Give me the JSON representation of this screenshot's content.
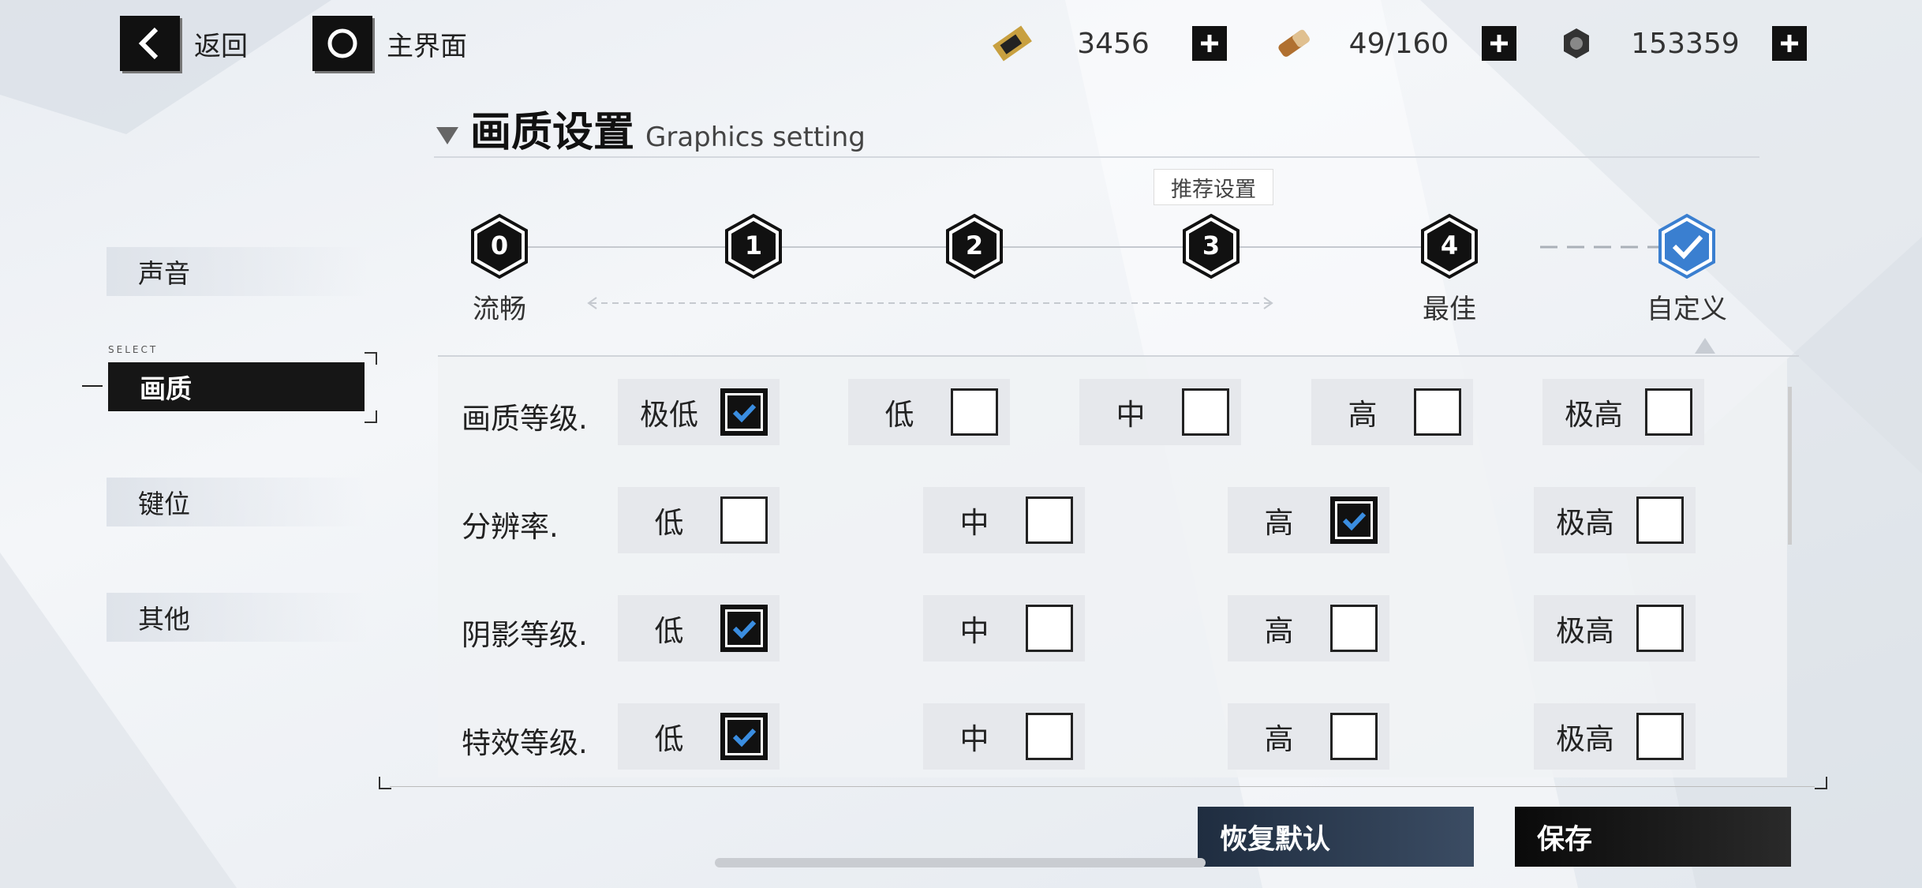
{
  "top": {
    "back_label": "返回",
    "home_label": "主界面",
    "resources": [
      {
        "icon": "ticket-icon",
        "value": "3456"
      },
      {
        "icon": "stamina-icon",
        "value": "49/160"
      },
      {
        "icon": "gear-icon",
        "value": "153359"
      }
    ]
  },
  "title": {
    "cn": "画质设置",
    "en": "Graphics setting"
  },
  "sidebar": {
    "select_tag": "SELECT",
    "items": [
      {
        "label": "声音",
        "active": false
      },
      {
        "label": "画质",
        "active": true
      },
      {
        "label": "键位",
        "active": false
      },
      {
        "label": "其他",
        "active": false
      }
    ]
  },
  "presets": {
    "recommend_tag": "推荐设置",
    "items": [
      {
        "num": "0",
        "label": "流畅"
      },
      {
        "num": "1",
        "label": ""
      },
      {
        "num": "2",
        "label": ""
      },
      {
        "num": "3",
        "label": ""
      },
      {
        "num": "4",
        "label": "最佳"
      },
      {
        "num": "✓",
        "label": "自定义"
      }
    ]
  },
  "settings": [
    {
      "label": "画质等级.",
      "options": [
        {
          "text": "极低",
          "checked": true
        },
        {
          "text": "低",
          "checked": false
        },
        {
          "text": "中",
          "checked": false
        },
        {
          "text": "高",
          "checked": false
        },
        {
          "text": "极高",
          "checked": false
        }
      ]
    },
    {
      "label": "分辨率.",
      "options": [
        {
          "text": "低",
          "checked": false
        },
        {
          "text": "中",
          "checked": false
        },
        {
          "text": "高",
          "checked": true
        },
        {
          "text": "极高",
          "checked": false
        }
      ]
    },
    {
      "label": "阴影等级.",
      "options": [
        {
          "text": "低",
          "checked": true
        },
        {
          "text": "中",
          "checked": false
        },
        {
          "text": "高",
          "checked": false
        },
        {
          "text": "极高",
          "checked": false
        }
      ]
    },
    {
      "label": "特效等级.",
      "options": [
        {
          "text": "低",
          "checked": true
        },
        {
          "text": "中",
          "checked": false
        },
        {
          "text": "高",
          "checked": false
        },
        {
          "text": "极高",
          "checked": false
        }
      ]
    }
  ],
  "buttons": {
    "reset_label": "恢复默认",
    "save_label": "保存"
  },
  "colors": {
    "accent": "#3a8de0",
    "dark": "#111111",
    "reset_bg": "#2b3a4e"
  }
}
